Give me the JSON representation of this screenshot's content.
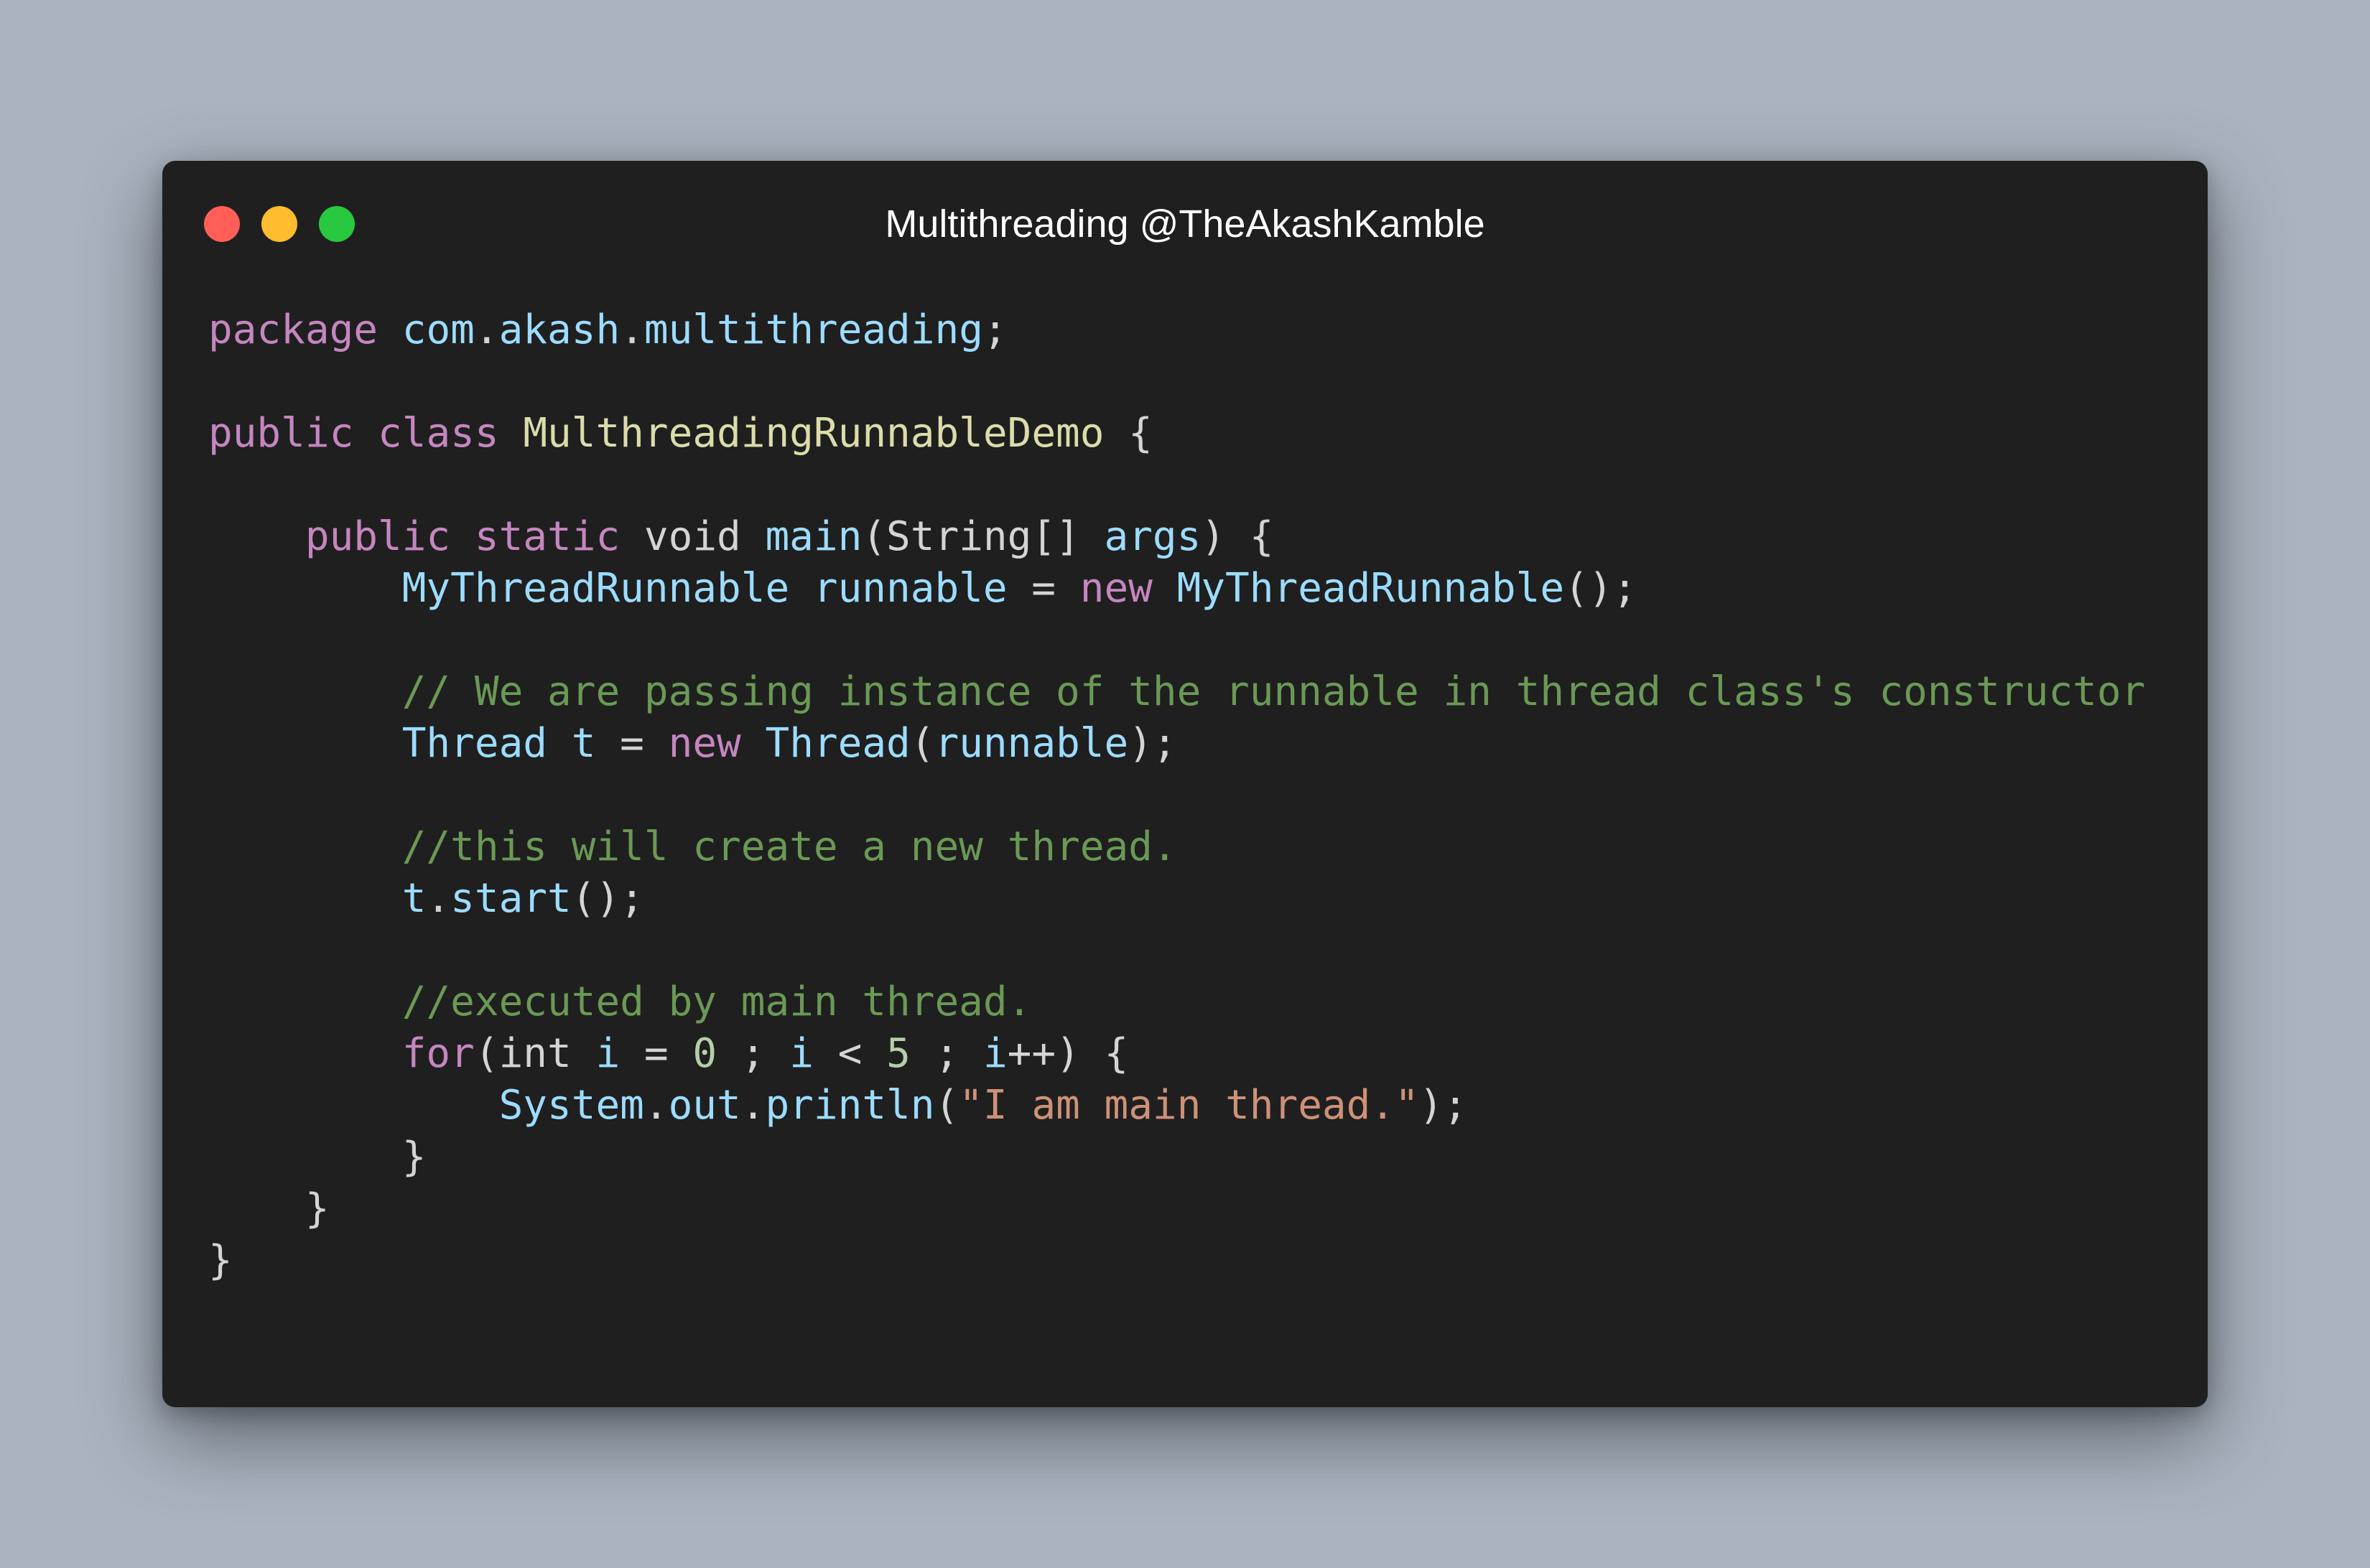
{
  "window": {
    "title": "Multithreading @TheAkashKamble",
    "controls": {
      "close": "#ff5f57",
      "minimize": "#febc2e",
      "maximize": "#28c840"
    }
  },
  "theme": {
    "background": "#a9b4c0",
    "editor_background": "#1f1f1f",
    "keyword": "#c586c0",
    "identifier": "#9cdcfe",
    "class_name": "#dcdcaa",
    "comment": "#6a9955",
    "string": "#ce9178",
    "number": "#b5cea8",
    "plain": "#d4d4d4"
  },
  "code": {
    "lines": [
      [
        {
          "t": "kw",
          "v": "package"
        },
        {
          "t": "plain",
          "v": " "
        },
        {
          "t": "id",
          "v": "com"
        },
        {
          "t": "plain",
          "v": "."
        },
        {
          "t": "id",
          "v": "akash"
        },
        {
          "t": "plain",
          "v": "."
        },
        {
          "t": "id",
          "v": "multithreading"
        },
        {
          "t": "plain",
          "v": ";"
        }
      ],
      [],
      [
        {
          "t": "kw",
          "v": "public"
        },
        {
          "t": "plain",
          "v": " "
        },
        {
          "t": "kw",
          "v": "class"
        },
        {
          "t": "plain",
          "v": " "
        },
        {
          "t": "cls",
          "v": "MulthreadingRunnableDemo"
        },
        {
          "t": "plain",
          "v": " {"
        }
      ],
      [],
      [
        {
          "t": "plain",
          "v": "    "
        },
        {
          "t": "kw",
          "v": "public"
        },
        {
          "t": "plain",
          "v": " "
        },
        {
          "t": "kw",
          "v": "static"
        },
        {
          "t": "plain",
          "v": " void "
        },
        {
          "t": "id",
          "v": "main"
        },
        {
          "t": "plain",
          "v": "(String[] "
        },
        {
          "t": "id",
          "v": "args"
        },
        {
          "t": "plain",
          "v": ") {"
        }
      ],
      [
        {
          "t": "plain",
          "v": "        "
        },
        {
          "t": "id",
          "v": "MyThreadRunnable"
        },
        {
          "t": "plain",
          "v": " "
        },
        {
          "t": "id",
          "v": "runnable"
        },
        {
          "t": "plain",
          "v": " = "
        },
        {
          "t": "kw",
          "v": "new"
        },
        {
          "t": "plain",
          "v": " "
        },
        {
          "t": "id",
          "v": "MyThreadRunnable"
        },
        {
          "t": "plain",
          "v": "();"
        }
      ],
      [],
      [
        {
          "t": "plain",
          "v": "        "
        },
        {
          "t": "cm",
          "v": "// We are passing instance of the runnable in thread class's constructor"
        }
      ],
      [
        {
          "t": "plain",
          "v": "        "
        },
        {
          "t": "id",
          "v": "Thread"
        },
        {
          "t": "plain",
          "v": " "
        },
        {
          "t": "id",
          "v": "t"
        },
        {
          "t": "plain",
          "v": " = "
        },
        {
          "t": "kw",
          "v": "new"
        },
        {
          "t": "plain",
          "v": " "
        },
        {
          "t": "id",
          "v": "Thread"
        },
        {
          "t": "plain",
          "v": "("
        },
        {
          "t": "id",
          "v": "runnable"
        },
        {
          "t": "plain",
          "v": ");"
        }
      ],
      [],
      [
        {
          "t": "plain",
          "v": "        "
        },
        {
          "t": "cm",
          "v": "//this will create a new thread."
        }
      ],
      [
        {
          "t": "plain",
          "v": "        "
        },
        {
          "t": "id",
          "v": "t"
        },
        {
          "t": "plain",
          "v": "."
        },
        {
          "t": "id",
          "v": "start"
        },
        {
          "t": "plain",
          "v": "();"
        }
      ],
      [],
      [
        {
          "t": "plain",
          "v": "        "
        },
        {
          "t": "cm",
          "v": "//executed by main thread."
        }
      ],
      [
        {
          "t": "plain",
          "v": "        "
        },
        {
          "t": "kw",
          "v": "for"
        },
        {
          "t": "plain",
          "v": "(int "
        },
        {
          "t": "id",
          "v": "i"
        },
        {
          "t": "plain",
          "v": " = "
        },
        {
          "t": "num",
          "v": "0"
        },
        {
          "t": "plain",
          "v": " ; "
        },
        {
          "t": "id",
          "v": "i"
        },
        {
          "t": "plain",
          "v": " < "
        },
        {
          "t": "num",
          "v": "5"
        },
        {
          "t": "plain",
          "v": " ; "
        },
        {
          "t": "id",
          "v": "i"
        },
        {
          "t": "plain",
          "v": "++) {"
        }
      ],
      [
        {
          "t": "plain",
          "v": "            "
        },
        {
          "t": "id",
          "v": "System"
        },
        {
          "t": "plain",
          "v": "."
        },
        {
          "t": "id",
          "v": "out"
        },
        {
          "t": "plain",
          "v": "."
        },
        {
          "t": "id",
          "v": "println"
        },
        {
          "t": "plain",
          "v": "("
        },
        {
          "t": "str",
          "v": "\"I am main thread.\""
        },
        {
          "t": "plain",
          "v": ");"
        }
      ],
      [
        {
          "t": "plain",
          "v": "        }"
        }
      ],
      [
        {
          "t": "plain",
          "v": "    }"
        }
      ],
      [
        {
          "t": "plain",
          "v": "}"
        }
      ]
    ]
  }
}
